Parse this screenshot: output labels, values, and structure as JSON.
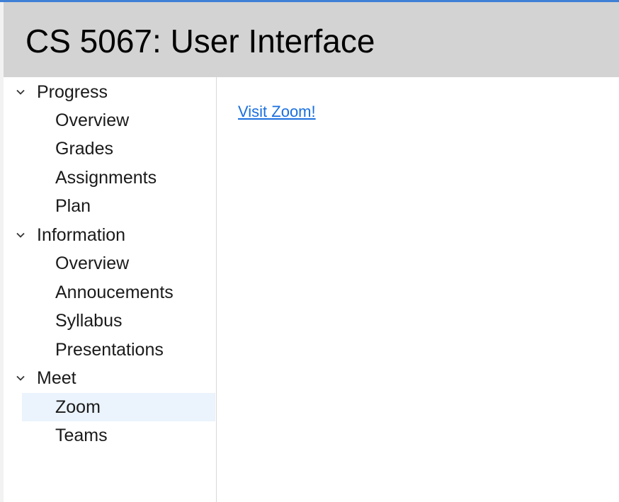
{
  "header": {
    "title": "CS 5067: User Interface"
  },
  "sidebar": {
    "groups": [
      {
        "label": "Progress",
        "icon": "chevron-down-icon",
        "items": [
          {
            "label": "Overview"
          },
          {
            "label": "Grades"
          },
          {
            "label": "Assignments"
          },
          {
            "label": "Plan"
          }
        ]
      },
      {
        "label": "Information",
        "icon": "chevron-down-icon",
        "items": [
          {
            "label": "Overview"
          },
          {
            "label": "Annoucements"
          },
          {
            "label": "Syllabus"
          },
          {
            "label": "Presentations"
          }
        ]
      },
      {
        "label": "Meet",
        "icon": "chevron-down-icon",
        "items": [
          {
            "label": "Zoom",
            "selected": true
          },
          {
            "label": "Teams"
          }
        ]
      }
    ]
  },
  "main": {
    "link_text": "Visit Zoom!"
  },
  "colors": {
    "header_bg": "#d3d3d3",
    "accent": "#3f7fd6",
    "link": "#1a6fdf",
    "selected_bg": "#ebf3fc"
  }
}
